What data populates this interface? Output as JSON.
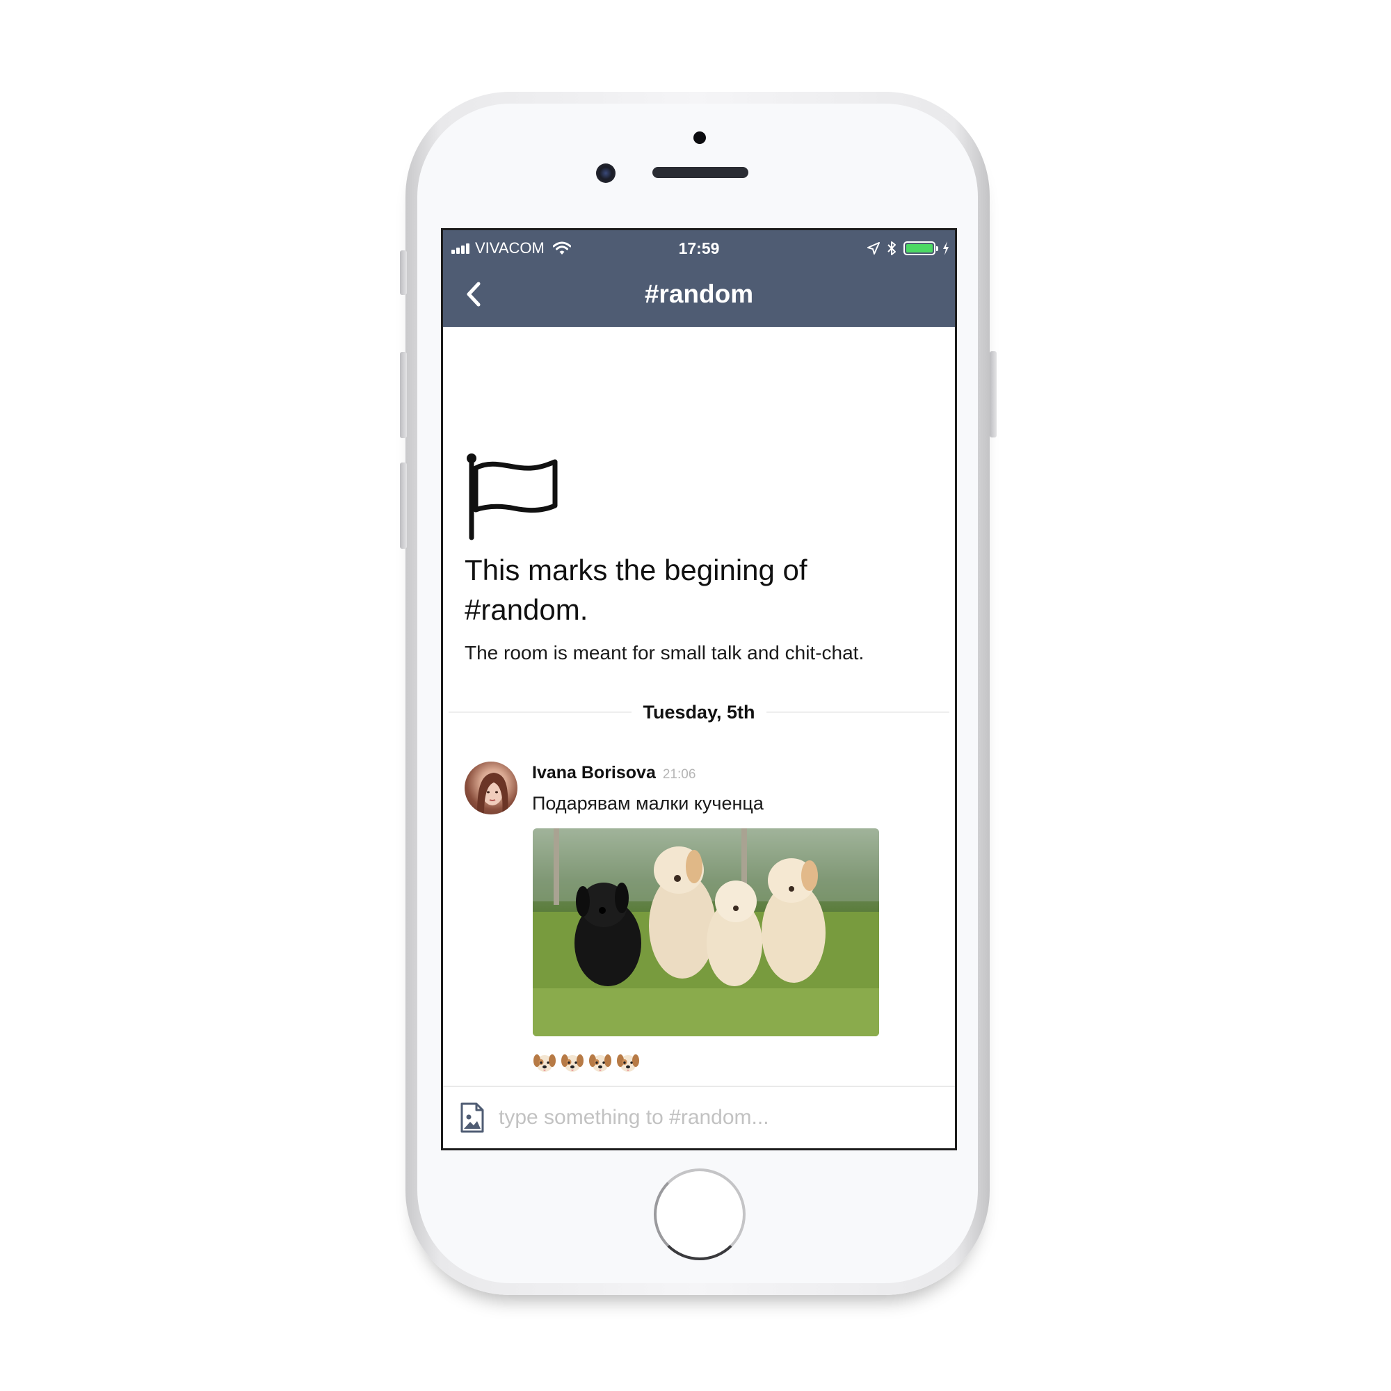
{
  "status_bar": {
    "carrier": "VIVACOM",
    "time": "17:59",
    "battery_level": 1.0,
    "icons": [
      "signal-icon",
      "wifi-icon",
      "location-icon",
      "bluetooth-icon",
      "battery-icon",
      "charging-icon"
    ]
  },
  "nav": {
    "title": "#random",
    "back_icon": "chevron-left-icon"
  },
  "intro": {
    "icon": "flag-icon",
    "title": "This marks the begining of #random.",
    "description": "The room is meant for small talk and chit-chat."
  },
  "date_divider": "Tuesday, 5th",
  "message": {
    "author": "Ivana Borisova",
    "time": "21:06",
    "text": "Подарявам малки кученца",
    "image_icon": "puppies-photo",
    "reactions": [
      "🐶",
      "🐶",
      "🐶",
      "🐶"
    ]
  },
  "composer": {
    "placeholder": "type something to #random...",
    "attach_icon": "image-attach-icon"
  },
  "colors": {
    "header_bg": "#4f5c73",
    "battery_green": "#4cd964",
    "placeholder": "#c2c2c2"
  }
}
